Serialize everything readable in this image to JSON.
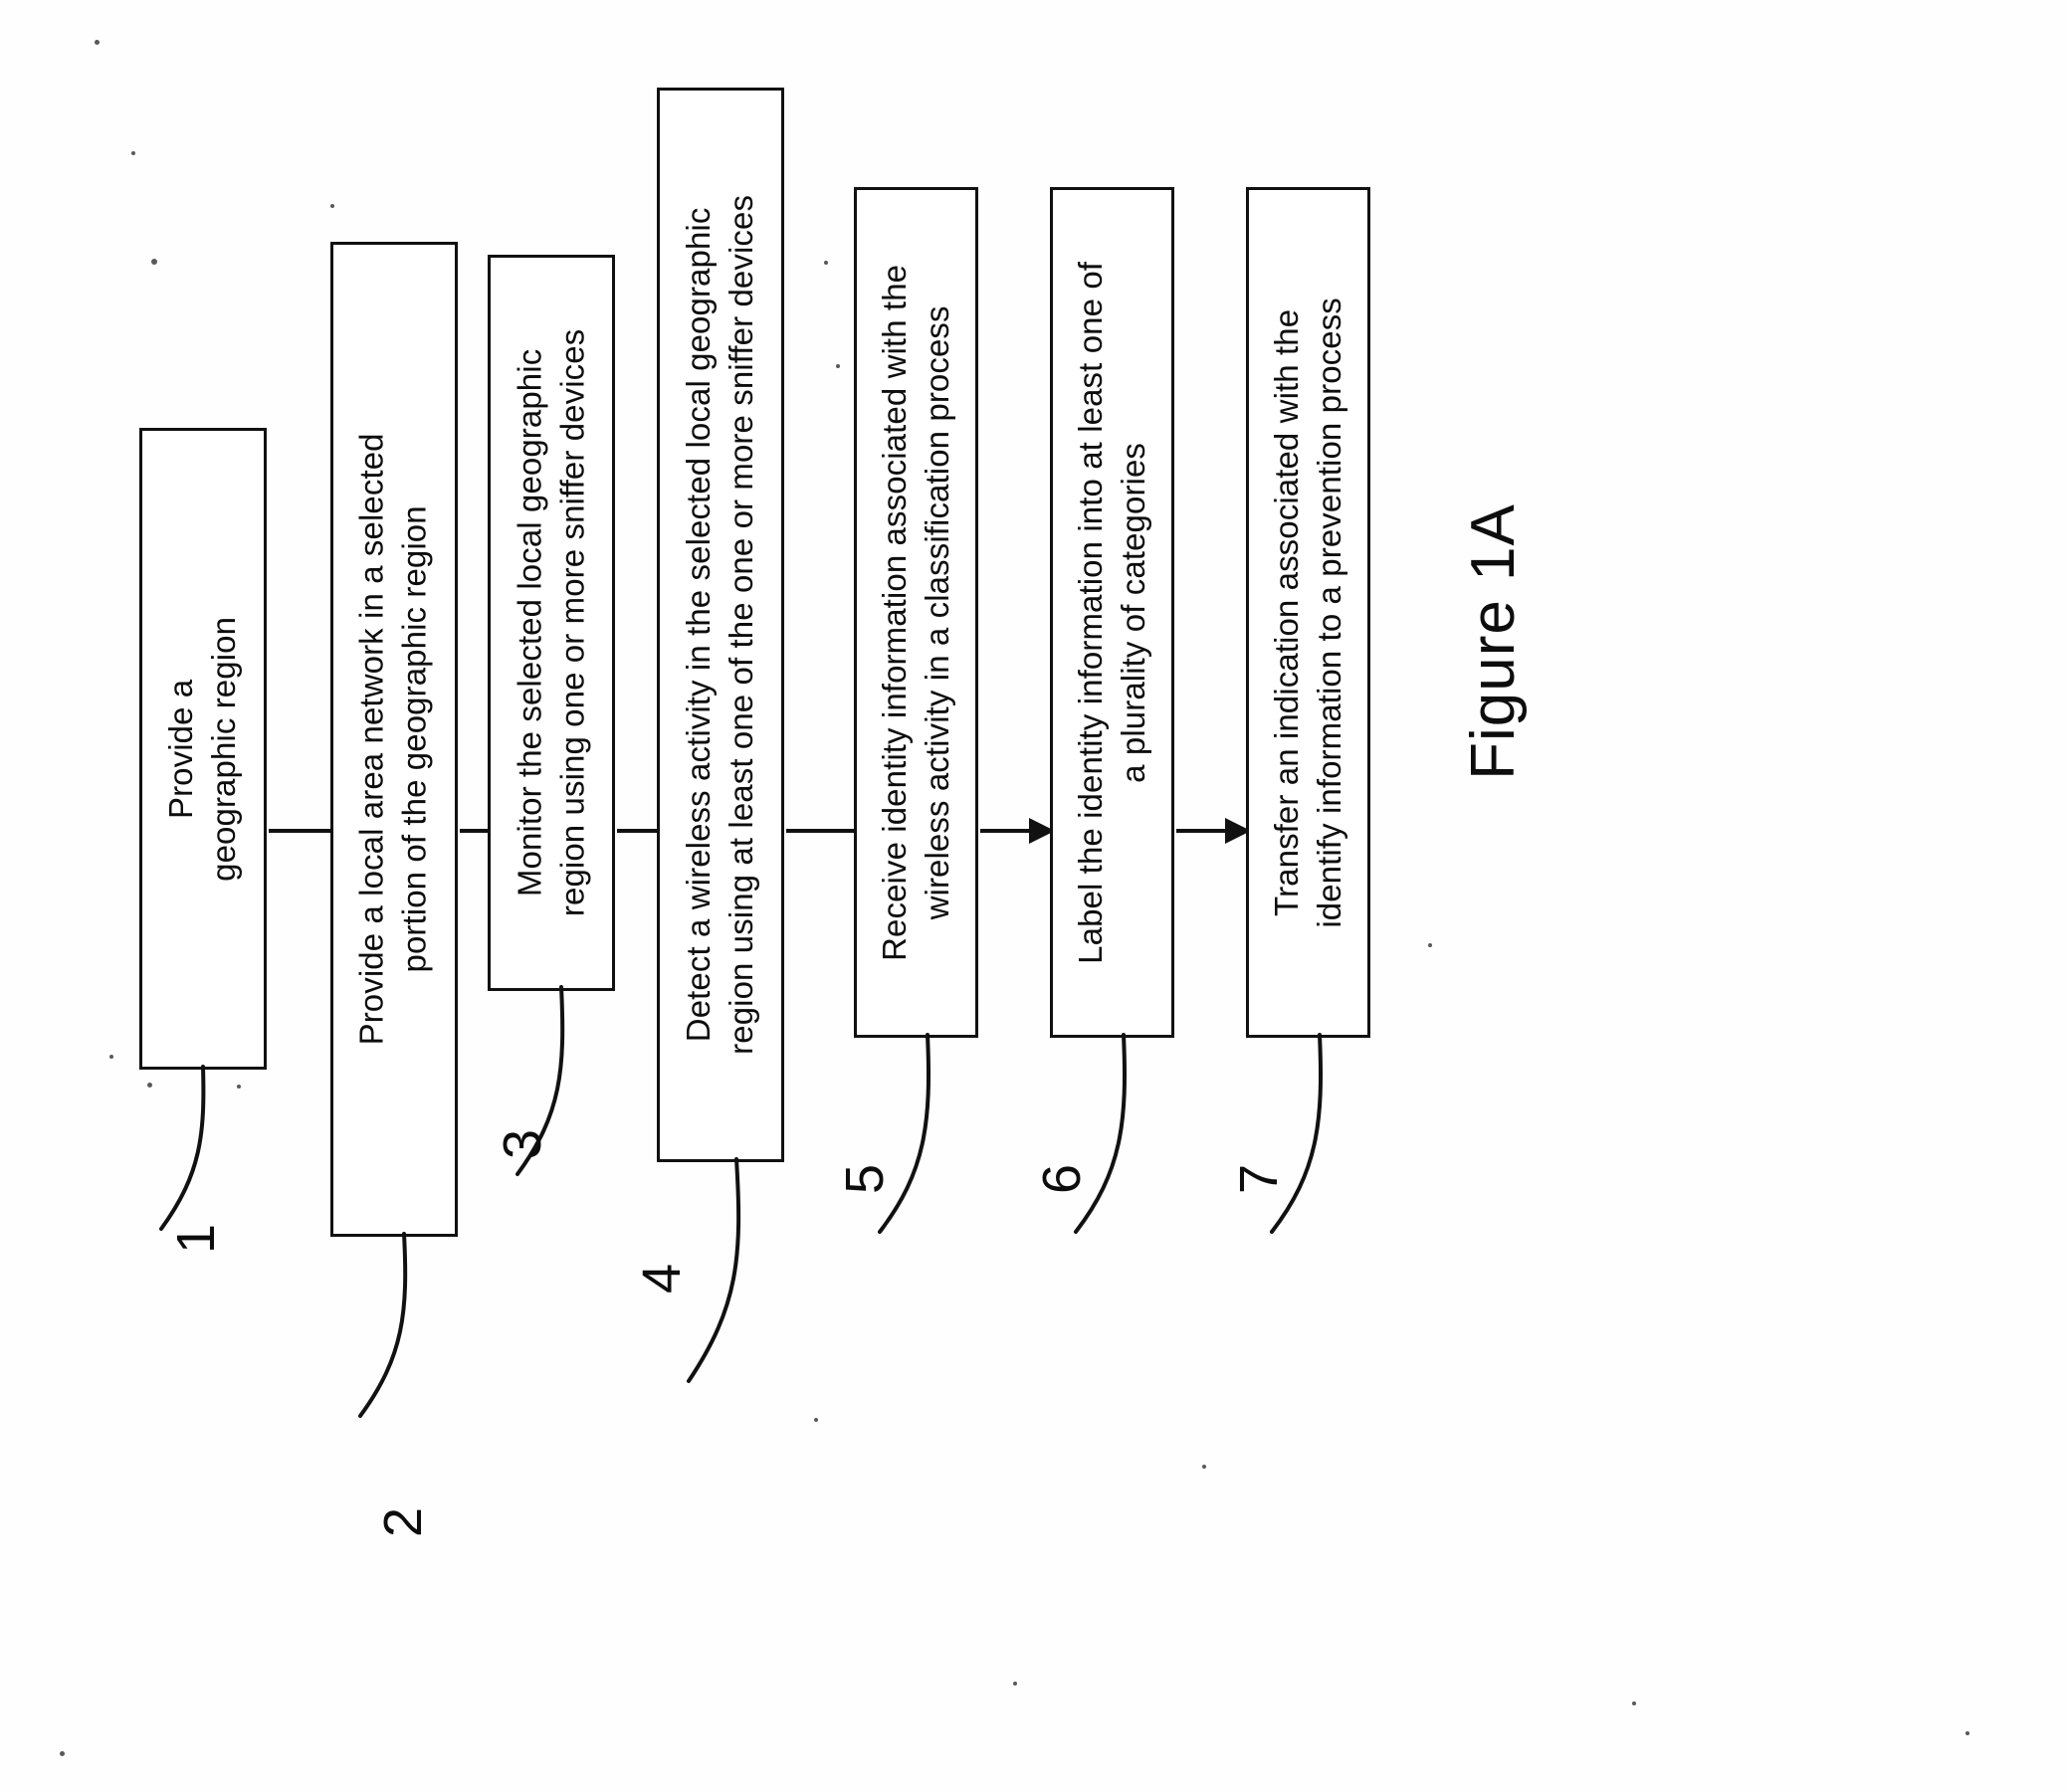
{
  "figure": {
    "caption": "Figure 1A",
    "orientation": "landscape-rotated-90",
    "background_color": "#ffffff",
    "ink_color": "#111111"
  },
  "flowchart": {
    "type": "patent-flow-diagram",
    "direction": "left-to-right",
    "steps": [
      {
        "ref": "1",
        "lines": [
          "Provide a",
          "geographic region"
        ],
        "text": "Provide a geographic region"
      },
      {
        "ref": "2",
        "lines": [
          "Provide a local area network in a selected",
          "portion of the geographic region"
        ],
        "text": "Provide a local area network in a selected portion of the geographic region"
      },
      {
        "ref": "3",
        "lines": [
          "Monitor the selected local geographic",
          "region using one or more sniffer devices"
        ],
        "text": "Monitor the selected local geographic region using one or more sniffer devices"
      },
      {
        "ref": "4",
        "lines": [
          "Detect a wireless activity in the selected local geographic",
          "region using at least one of the one or more sniffer devices"
        ],
        "text": "Detect a wireless activity in the selected local geographic region using at least one of the one or more sniffer devices"
      },
      {
        "ref": "5",
        "lines": [
          "Receive identity information associated with the",
          "wireless activity in a classification process"
        ],
        "text": "Receive identity information associated with the wireless activity in a classification process"
      },
      {
        "ref": "6",
        "lines": [
          "Label the identity information into at least one of",
          "a plurality of categories"
        ],
        "text": "Label the identity information into at least one of a plurality of categories"
      },
      {
        "ref": "7",
        "lines": [
          "Transfer an indication associated with the",
          "identify information to a prevention process"
        ],
        "text": "Transfer an indication associated with the identify information to a prevention process"
      }
    ],
    "connectors": [
      {
        "from": "1",
        "to": "2",
        "style": "arrow"
      },
      {
        "from": "2",
        "to": "3",
        "style": "arrow"
      },
      {
        "from": "3",
        "to": "4",
        "style": "arrow"
      },
      {
        "from": "4",
        "to": "5",
        "style": "arrow"
      },
      {
        "from": "5",
        "to": "6",
        "style": "arrow"
      },
      {
        "from": "6",
        "to": "7",
        "style": "arrow"
      }
    ]
  }
}
